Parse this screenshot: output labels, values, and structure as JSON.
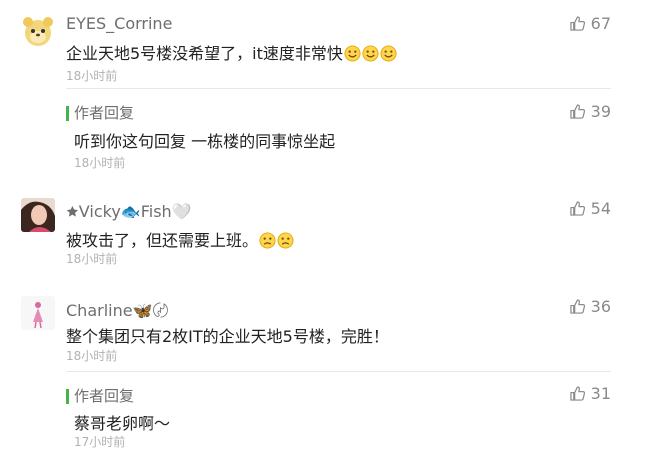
{
  "comments": [
    {
      "author": "EYES_Corrine",
      "content": "企业天地5号楼没希望了，it速度非常快",
      "emojis": [
        "smile",
        "smile",
        "smile"
      ],
      "time": "18小时前",
      "likes": "67",
      "reply": {
        "label": "作者回复",
        "content": "听到你这句回复 一栋楼的同事惊坐起",
        "time": "18小时前",
        "likes": "39"
      }
    },
    {
      "author": "🟊Vicky🐟Fish🤍",
      "content": "被攻击了，但还需要上班。",
      "emojis": [
        "sad",
        "sad"
      ],
      "time": "18小时前",
      "likes": "54"
    },
    {
      "author": "Charline🦋〄",
      "content": "整个集团只有2枚IT的企业天地5号楼，完胜！",
      "time": "18小时前",
      "likes": "36",
      "reply": {
        "label": "作者回复",
        "content": "蔡哥老卵啊～",
        "time": "17小时前",
        "likes": "31"
      }
    }
  ],
  "icons": {
    "like": "thumbs-up-icon",
    "smile_emoji": "smile-emoji-icon",
    "sad_emoji": "sad-emoji-icon"
  },
  "colors": {
    "accent_green": "#44b549",
    "like_gray": "#8a8a8a"
  }
}
